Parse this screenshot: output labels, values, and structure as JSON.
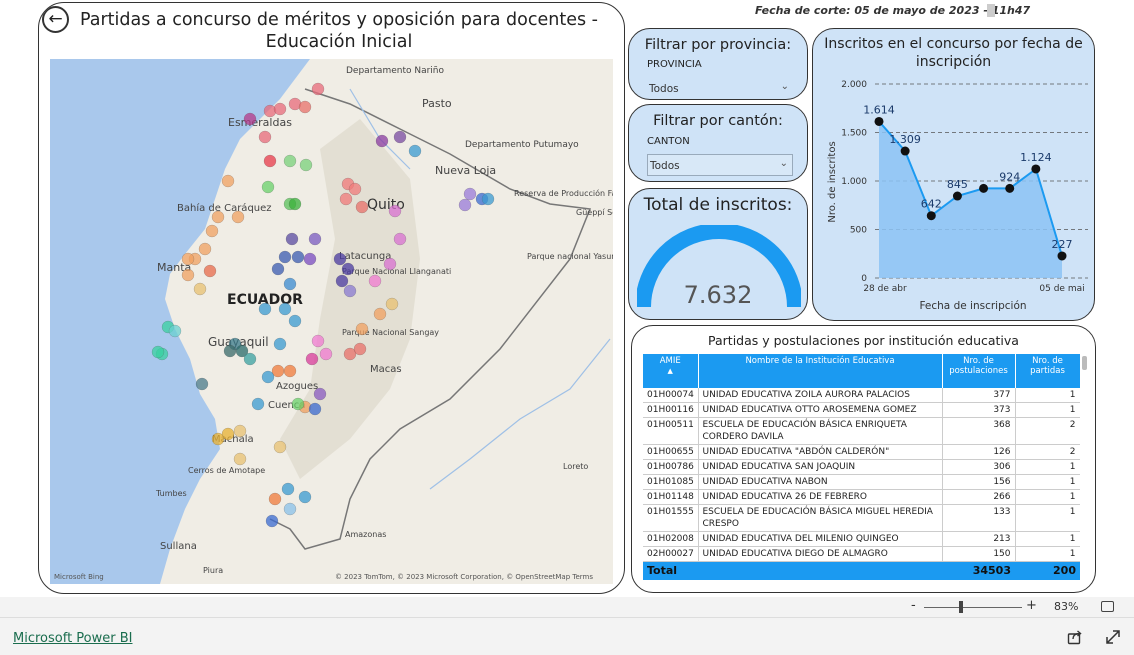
{
  "header": {
    "cutoff": "Fecha de corte: 05 de mayo de 2023 - 11h47"
  },
  "map": {
    "title": "Partidas a concurso de méritos y oposición para docentes - Educación Inicial",
    "back_icon": "back-arrow-icon",
    "country_label": "ECUADOR",
    "places": [
      "Departamento Nariño",
      "Pasto",
      "Departamento Putumayo",
      "Esmeraldas",
      "Nueva Loja",
      "Quito",
      "Bahía de Caráquez",
      "Reserva de Producción Faunística Cuyabeno",
      "Güeppí Sekime",
      "Manta",
      "Latacunga",
      "Parque Nacional Llanganati",
      "Parque nacional Yasuní",
      "Guayaquil",
      "Parque Nacional Sangay",
      "Macas",
      "Azogues",
      "Cuenca",
      "Machala",
      "Cerros de Amotape",
      "Tumbes",
      "Loreto",
      "Amazonas",
      "Sullana",
      "Piura"
    ],
    "attribution": "© 2023 TomTom, © 2023 Microsoft Corporation, © OpenStreetMap  Terms",
    "bing": "Microsoft Bing",
    "water_color": "#a9c8ec",
    "land_color": "#f0ede5"
  },
  "filters": {
    "province": {
      "title": "Filtrar por provincia:",
      "label": "PROVINCIA",
      "value": "Todos"
    },
    "canton": {
      "title": "Filtrar por cantón:",
      "label": "CANTON",
      "value": "Todos"
    }
  },
  "total": {
    "title": "Total de inscritos:",
    "value": "7.632",
    "gauge_fraction": 1.0,
    "gauge_color": "#1b9af1"
  },
  "chart_data": {
    "type": "area",
    "title": "Inscritos en el concurso por fecha de inscripción",
    "xlabel": "Fecha de inscripción",
    "ylabel": "Nro. de inscritos",
    "x_tick_labels": [
      "28 de abr",
      "05 de mai"
    ],
    "y_tick_labels": [
      "0",
      "500",
      "1.000",
      "1.500",
      "2.000"
    ],
    "ylim": [
      0,
      2000
    ],
    "x": [
      "28 de abr",
      "29 de abr",
      "30 de abr",
      "01 de may",
      "02 de may",
      "03 de may",
      "04 de may",
      "05 de may"
    ],
    "values": [
      1614,
      1309,
      642,
      845,
      924,
      924,
      1124,
      227
    ],
    "data_labels": [
      "1.614",
      "1.309",
      "642",
      "845",
      "",
      "924",
      "1.124",
      "227"
    ],
    "grid": true,
    "fill_color": "#8cc3f5",
    "line_color": "#1b9af1"
  },
  "table": {
    "title": "Partidas y postulaciones por institución educativa",
    "columns": [
      "AMIE",
      "Nombre de la Institución Educativa",
      "Nro. de postulaciones",
      "Nro. de partidas"
    ],
    "rows": [
      [
        "01H00074",
        "UNIDAD EDUCATIVA ZOILA AURORA PALACIOS",
        "377",
        "1"
      ],
      [
        "01H00116",
        "UNIDAD EDUCATIVA OTTO AROSEMENA GOMEZ",
        "373",
        "1"
      ],
      [
        "01H00511",
        "ESCUELA DE EDUCACIÓN BÁSICA ENRIQUETA CORDERO DAVILA",
        "368",
        "2"
      ],
      [
        "01H00655",
        "UNIDAD EDUCATIVA \"ABDÓN CALDERÓN\"",
        "126",
        "2"
      ],
      [
        "01H00786",
        "UNIDAD EDUCATIVA SAN JOAQUIN",
        "306",
        "1"
      ],
      [
        "01H01085",
        "UNIDAD EDUCATIVA NABON",
        "156",
        "1"
      ],
      [
        "01H01148",
        "UNIDAD EDUCATIVA 26 DE FEBRERO",
        "266",
        "1"
      ],
      [
        "01H01555",
        "ESCUELA DE EDUCACIÓN BÁSICA MIGUEL HEREDIA CRESPO",
        "133",
        "1"
      ],
      [
        "01H02008",
        "UNIDAD EDUCATIVA DEL MILENIO QUINGEO",
        "213",
        "1"
      ],
      [
        "02H00027",
        "UNIDAD EDUCATIVA DIEGO DE ALMAGRO",
        "150",
        "1"
      ]
    ],
    "total": {
      "label": "Total",
      "postulaciones": "34503",
      "partidas": "200"
    }
  },
  "footer": {
    "zoom_minus": "-",
    "zoom_plus": "+",
    "zoom_value": "83%",
    "link": "Microsoft Power BI"
  }
}
